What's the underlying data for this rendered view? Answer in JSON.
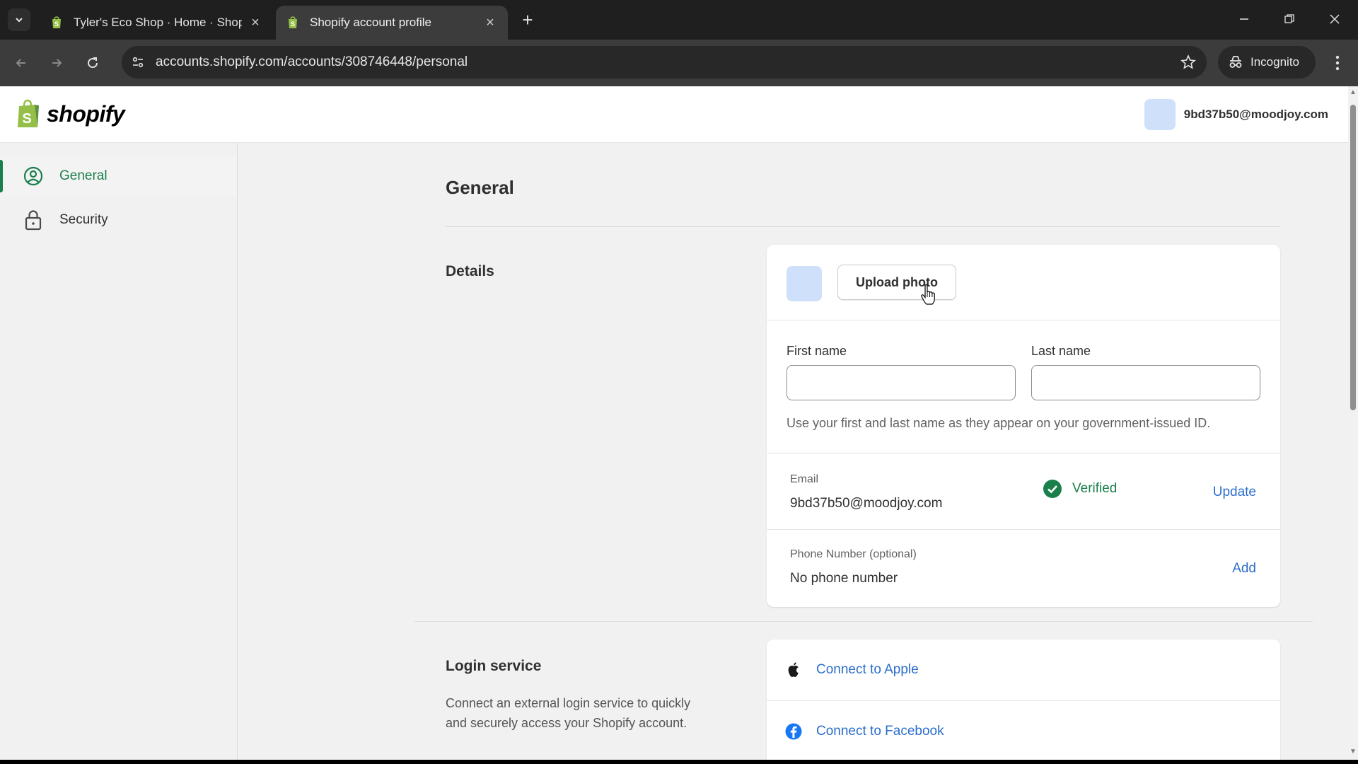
{
  "browser": {
    "tabs": [
      {
        "title": "Tyler's Eco Shop · Home · Shopify",
        "active": false
      },
      {
        "title": "Shopify account profile",
        "active": true
      }
    ],
    "url": "accounts.shopify.com/accounts/308746448/personal",
    "incognito_label": "Incognito"
  },
  "header": {
    "logo_text": "shopify",
    "account_email": "9bd37b50@moodjoy.com"
  },
  "sidebar": {
    "items": [
      {
        "label": "General",
        "icon": "user-circle-icon",
        "active": true
      },
      {
        "label": "Security",
        "icon": "lock-icon",
        "active": false
      }
    ]
  },
  "main": {
    "page_title": "General",
    "details": {
      "section_label": "Details",
      "upload_photo_label": "Upload photo",
      "first_name_label": "First name",
      "first_name_value": "",
      "last_name_label": "Last name",
      "last_name_value": "",
      "name_help": "Use your first and last name as they appear on your government-issued ID.",
      "email_label": "Email",
      "email_value": "9bd37b50@moodjoy.com",
      "verified_label": "Verified",
      "update_label": "Update",
      "phone_label": "Phone Number (optional)",
      "phone_value": "No phone number",
      "add_label": "Add"
    },
    "login_service": {
      "section_label": "Login service",
      "description": "Connect an external login service to quickly and securely access your Shopify account.",
      "apple_label": "Connect to Apple",
      "facebook_label": "Connect to Facebook"
    }
  },
  "colors": {
    "brand_green": "#1a7f4a",
    "link_blue": "#2c6ecb",
    "avatar_blue": "#cfe0fb"
  }
}
